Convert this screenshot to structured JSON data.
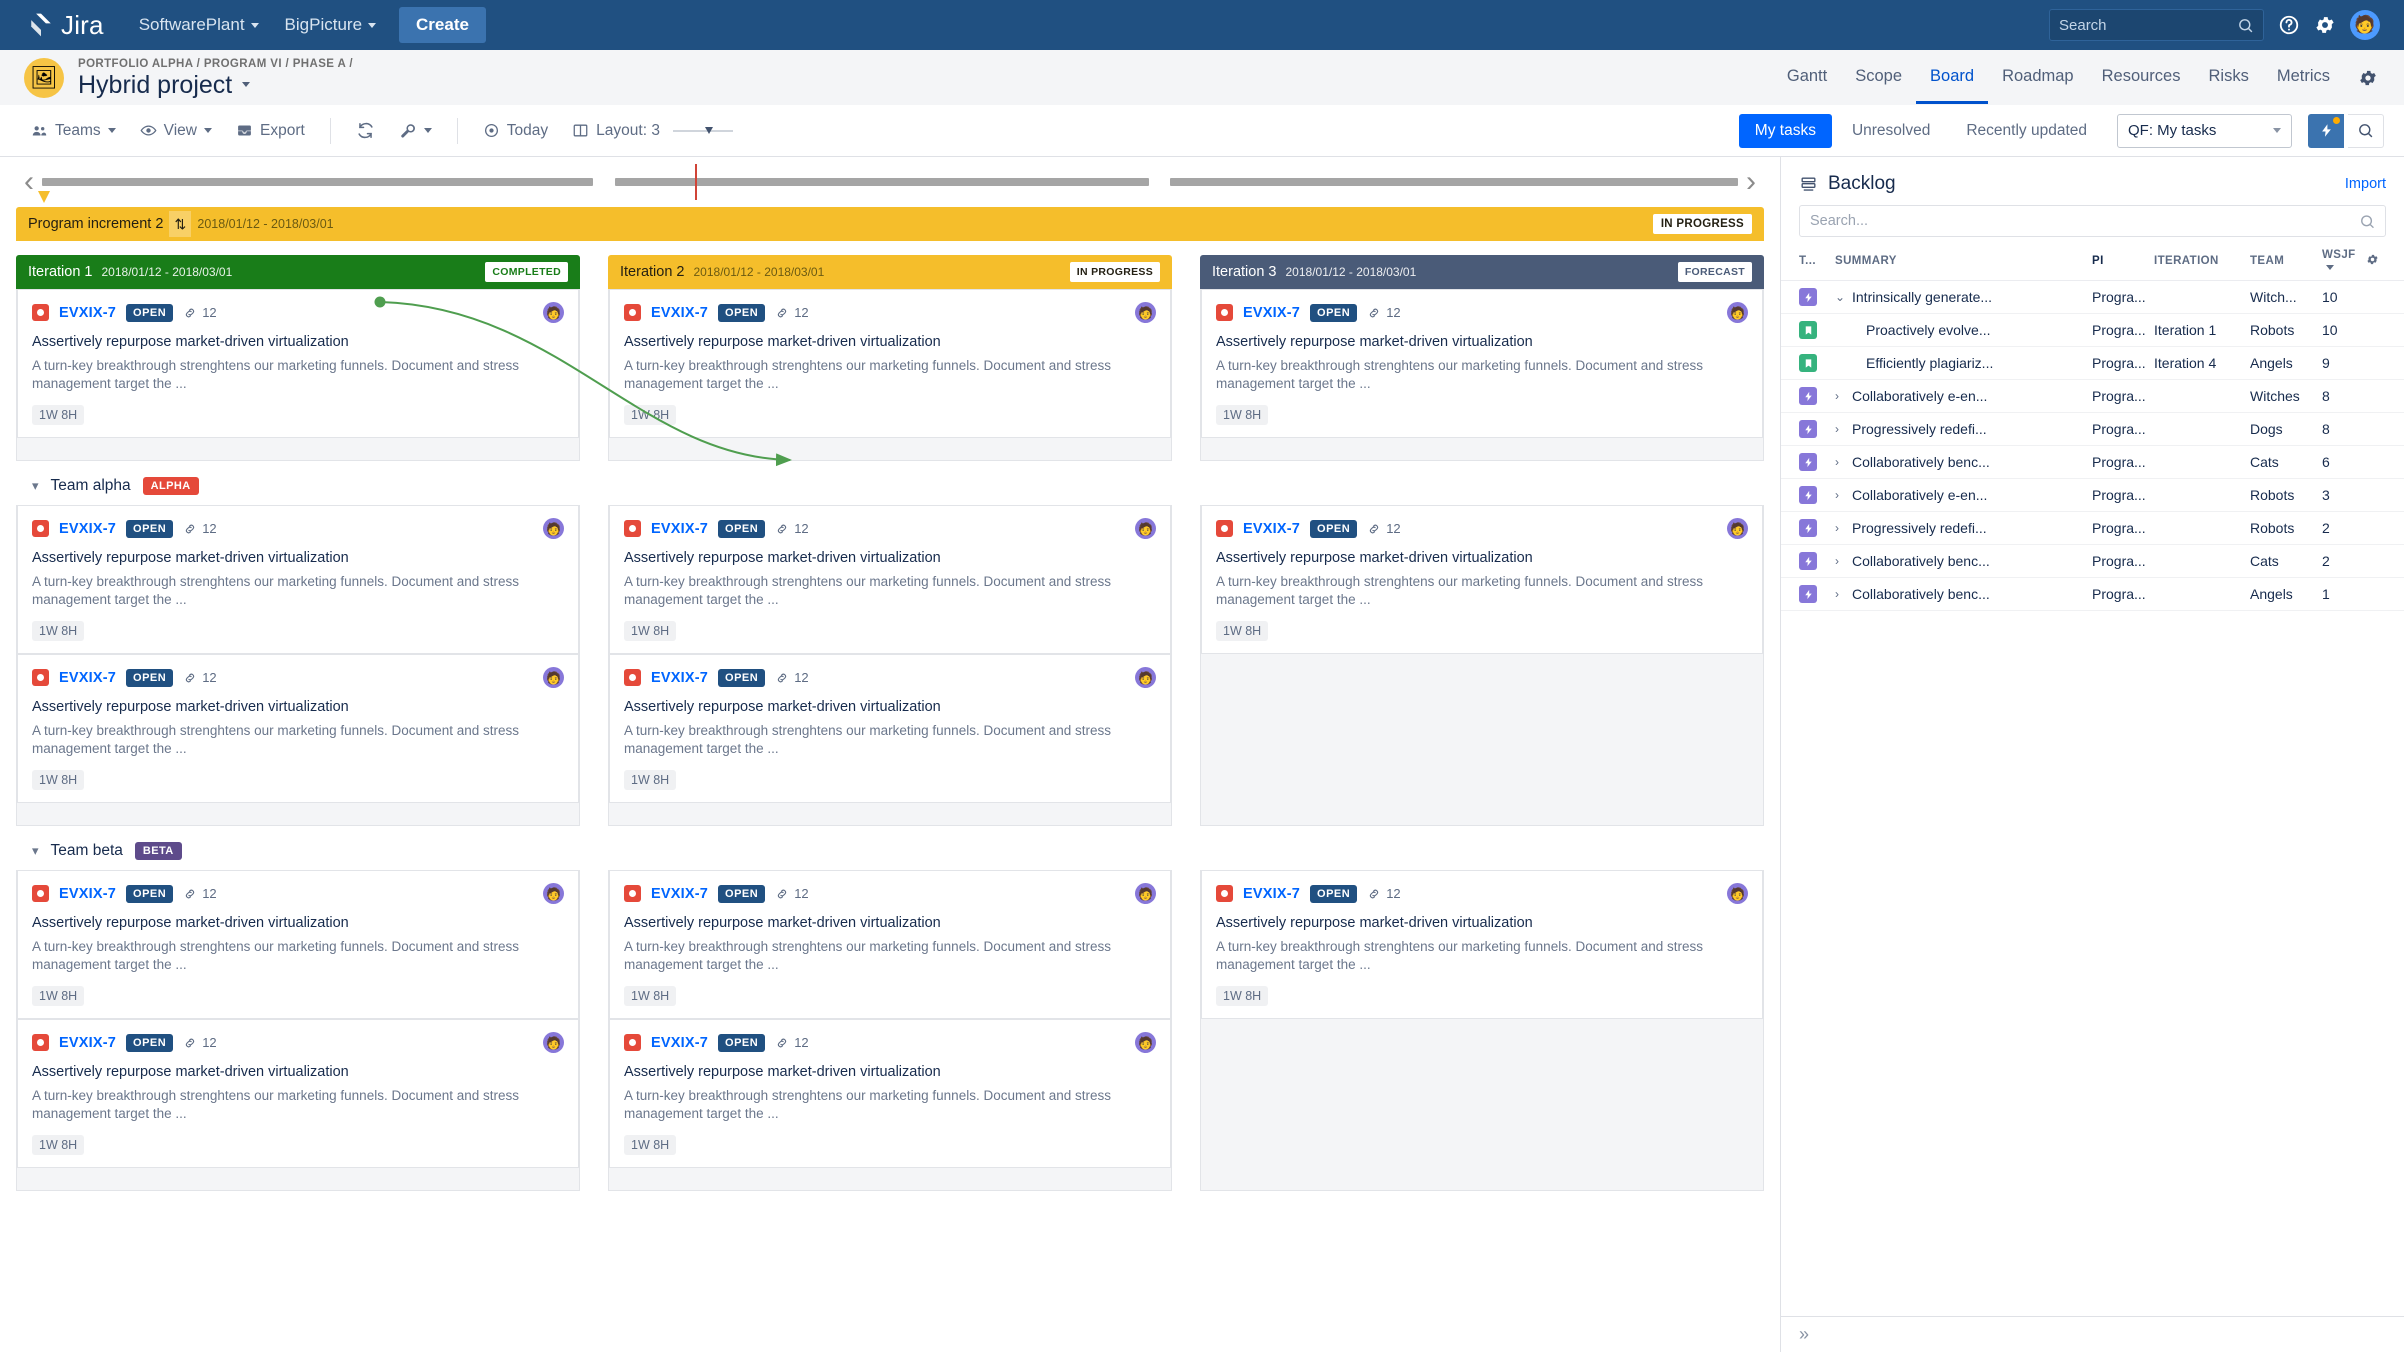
{
  "topnav": {
    "brand": "Jira",
    "items": [
      {
        "label": "SoftwarePlant",
        "caret": true
      },
      {
        "label": "BigPicture",
        "caret": true
      }
    ],
    "create_label": "Create",
    "search_placeholder": "Search",
    "icons": {
      "help": "help-icon",
      "settings": "gear-icon",
      "avatar": "user-avatar"
    },
    "bg_color": "#205081"
  },
  "project": {
    "breadcrumb": "PORTFOLIO ALPHA / PROGRAM VI / PHASE A /",
    "title": "Hybrid project",
    "avatar_glyph": "🖼",
    "tabs": [
      {
        "label": "Gantt",
        "active": false
      },
      {
        "label": "Scope",
        "active": false
      },
      {
        "label": "Board",
        "active": true
      },
      {
        "label": "Roadmap",
        "active": false
      },
      {
        "label": "Resources",
        "active": false
      },
      {
        "label": "Risks",
        "active": false
      },
      {
        "label": "Metrics",
        "active": false
      }
    ],
    "settings_icon": "gear-icon"
  },
  "toolbar": {
    "left": [
      {
        "label": "Teams",
        "icon": "people-icon",
        "caret": true
      },
      {
        "label": "View",
        "icon": "eye-icon",
        "caret": true
      },
      {
        "label": "Export",
        "icon": "export-icon",
        "caret": false
      }
    ],
    "refresh_icon": "refresh-icon",
    "wrench_icon": "wrench-icon",
    "today_label": "Today",
    "today_icon": "target-icon",
    "layout_label": "Layout: 3",
    "layout_icon": "columns-icon",
    "quick_filters": [
      {
        "label": "My tasks",
        "active": true
      },
      {
        "label": "Unresolved",
        "active": false
      },
      {
        "label": "Recently updated",
        "active": false
      }
    ],
    "qf_select_value": "QF: My tasks",
    "bolt_icon": "lightning-icon",
    "search_icon": "search-icon"
  },
  "program_increment": {
    "name": "Program increment 2",
    "dates": "2018/01/12 - 2018/03/01",
    "status": "IN PROGRESS",
    "color": "#f5be2b",
    "sort_icon": "sort-icon"
  },
  "timeline": {
    "prev_icon": "chevron-left-icon",
    "next_icon": "chevron-right-icon",
    "today_marker_color": "#d04437"
  },
  "columns": [
    {
      "name": "Iteration 1",
      "dates": "2018/01/12 - 2018/03/01",
      "badge": "COMPLETED",
      "color": "#197d19",
      "variant": "c-completed"
    },
    {
      "name": "Iteration 2",
      "dates": "2018/01/12 - 2018/03/01",
      "badge": "IN PROGRESS",
      "color": "#f5be2b",
      "variant": "c-inprogress"
    },
    {
      "name": "Iteration 3",
      "dates": "2018/01/12 - 2018/03/01",
      "badge": "FORECAST",
      "color": "#4a5b78",
      "variant": "c-forecast"
    }
  ],
  "card": {
    "key": "EVXIX-7",
    "status": "OPEN",
    "links_count": "12",
    "title": "Assertively repurpose market-driven virtualization",
    "description": "A turn-key breakthrough strenghtens our marketing funnels. Document and stress management target the ...",
    "estimate": "1W 8H",
    "type_icon": "bug-icon",
    "link_icon": "link-icon",
    "avatar_glyph": "🧑",
    "status_color": "#205081"
  },
  "teams": [
    {
      "name": "Team alpha",
      "badge": "ALPHA",
      "badge_color": "#e5493a"
    },
    {
      "name": "Team beta",
      "badge": "BETA",
      "badge_color": "#5e4b8b"
    }
  ],
  "backlog": {
    "title": "Backlog",
    "icon": "backlog-icon",
    "import_label": "Import",
    "search_placeholder": "Search...",
    "search_icon": "search-icon",
    "gear_icon": "gear-icon",
    "columns": [
      "T...",
      "SUMMARY",
      "PI",
      "ITERATION",
      "TEAM",
      "WSJF"
    ],
    "sort_column": "WSJF",
    "rows": [
      {
        "type": "epic",
        "expander": "v",
        "indent": false,
        "summary": "Intrinsically generate...",
        "pi": "Progra...",
        "iteration": "",
        "team": "Witch...",
        "wsjf": "10"
      },
      {
        "type": "story",
        "expander": "",
        "indent": true,
        "summary": "Proactively evolve...",
        "pi": "Progra...",
        "iteration": "Iteration 1",
        "team": "Robots",
        "wsjf": "10"
      },
      {
        "type": "story",
        "expander": "",
        "indent": true,
        "summary": "Efficiently plagiariz...",
        "pi": "Progra...",
        "iteration": "Iteration 4",
        "team": "Angels",
        "wsjf": "9"
      },
      {
        "type": "epic",
        "expander": ">",
        "indent": false,
        "summary": "Collaboratively e-en...",
        "pi": "Progra...",
        "iteration": "",
        "team": "Witches",
        "wsjf": "8"
      },
      {
        "type": "epic",
        "expander": ">",
        "indent": false,
        "summary": "Progressively redefi...",
        "pi": "Progra...",
        "iteration": "",
        "team": "Dogs",
        "wsjf": "8"
      },
      {
        "type": "epic",
        "expander": ">",
        "indent": false,
        "summary": "Collaboratively benc...",
        "pi": "Progra...",
        "iteration": "",
        "team": "Cats",
        "wsjf": "6"
      },
      {
        "type": "epic",
        "expander": ">",
        "indent": false,
        "summary": "Collaboratively e-en...",
        "pi": "Progra...",
        "iteration": "",
        "team": "Robots",
        "wsjf": "3"
      },
      {
        "type": "epic",
        "expander": ">",
        "indent": false,
        "summary": "Progressively redefi...",
        "pi": "Progra...",
        "iteration": "",
        "team": "Robots",
        "wsjf": "2"
      },
      {
        "type": "epic",
        "expander": ">",
        "indent": false,
        "summary": "Collaboratively benc...",
        "pi": "Progra...",
        "iteration": "",
        "team": "Cats",
        "wsjf": "2"
      },
      {
        "type": "epic",
        "expander": ">",
        "indent": false,
        "summary": "Collaboratively benc...",
        "pi": "Progra...",
        "iteration": "",
        "team": "Angels",
        "wsjf": "1"
      }
    ],
    "collapse_icon": "»"
  },
  "dependency_arrow": {
    "color": "#4f9e4f",
    "from": "Iteration 1 PI row card",
    "to": "Iteration 3 Team alpha card"
  }
}
